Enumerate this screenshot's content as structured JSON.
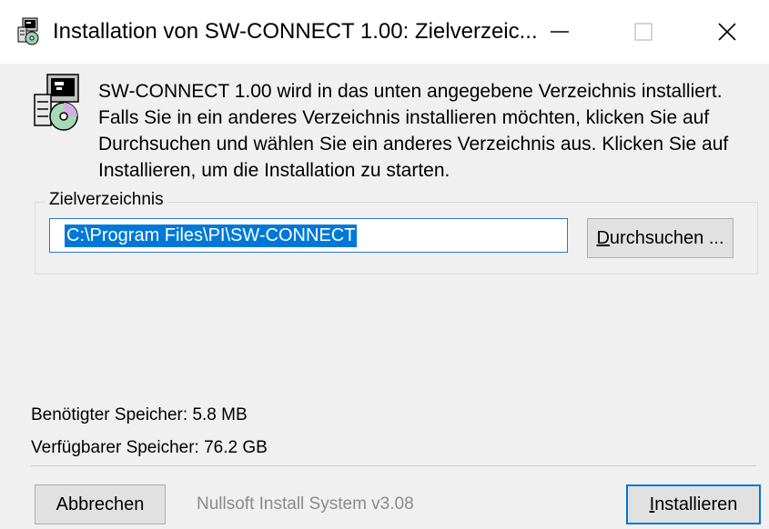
{
  "window": {
    "title": "Installation von SW-CONNECT 1.00: Zielverzeic..."
  },
  "header": {
    "description": "SW-CONNECT 1.00 wird in das unten angegebene Verzeichnis installiert.\nFalls Sie in ein anderes Verzeichnis installieren möchten, klicken Sie auf\nDurchsuchen und wählen Sie ein anderes Verzeichnis aus. Klicken Sie auf\nInstallieren, um die Installation zu starten.",
    "icon": "installer-disk-icon"
  },
  "destination": {
    "group_label": "Zielverzeichnis",
    "path_value": "C:\\Program Files\\PI\\SW-CONNECT",
    "browse_label_accel": "D",
    "browse_label_rest": "urchsuchen ..."
  },
  "space": {
    "required": "Benötigter Speicher: 5.8 MB",
    "available": "Verfügbarer Speicher: 76.2 GB"
  },
  "footer": {
    "branding": "Nullsoft Install System v3.08",
    "cancel_label": "Abbrechen",
    "install_label_accel": "I",
    "install_label_rest": "nstallieren"
  },
  "colors": {
    "selection": "#0078d7",
    "focus_border": "#0078d7",
    "dialog_bg": "#f0f0f0"
  }
}
